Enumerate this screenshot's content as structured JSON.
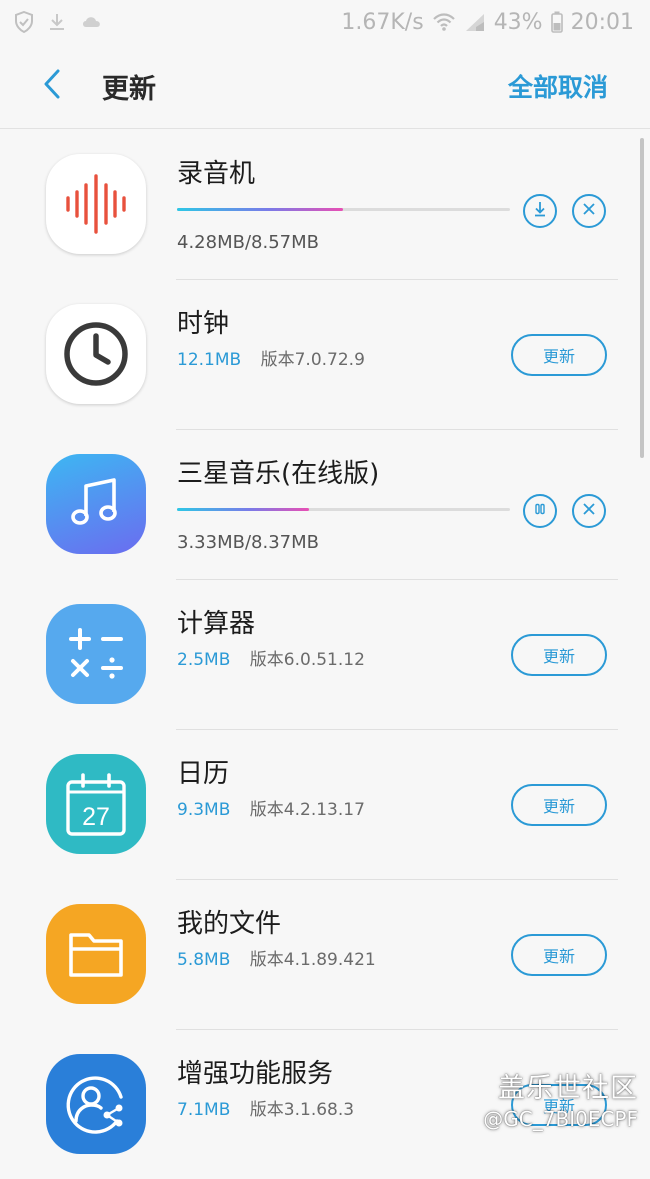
{
  "status_bar": {
    "net_speed": "1.67K/s",
    "battery": "43%",
    "time": "20:01",
    "icons": [
      "shield-icon",
      "download-icon",
      "cloud-icon",
      "wifi-icon",
      "signal-icon",
      "battery-icon"
    ]
  },
  "header": {
    "title": "更新",
    "cancel_all": "全部取消"
  },
  "apps": [
    {
      "name": "录音机",
      "state": "downloading",
      "progress_text": "4.28MB/8.57MB",
      "progress_fraction": 0.4994
    },
    {
      "name": "时钟",
      "state": "update",
      "size": "12.1MB",
      "version": "版本7.0.72.9",
      "button": "更新"
    },
    {
      "name": "三星音乐(在线版)",
      "state": "downloading",
      "progress_text": "3.33MB/8.37MB",
      "progress_fraction": 0.3978
    },
    {
      "name": "计算器",
      "state": "update",
      "size": "2.5MB",
      "version": "版本6.0.51.12",
      "button": "更新"
    },
    {
      "name": "日历",
      "state": "update",
      "size": "9.3MB",
      "version": "版本4.2.13.17",
      "button": "更新",
      "icon_text": "27"
    },
    {
      "name": "我的文件",
      "state": "update",
      "size": "5.8MB",
      "version": "版本4.1.89.421",
      "button": "更新"
    },
    {
      "name": "增强功能服务",
      "state": "update",
      "size": "7.1MB",
      "version": "版本3.1.68.3",
      "button": "更新"
    }
  ],
  "watermark": {
    "line1": "盖乐世社区",
    "line2": "@GC_7BI0ECPF"
  },
  "colors": {
    "accent": "#2b9ad6",
    "background": "#f7f7f7"
  }
}
